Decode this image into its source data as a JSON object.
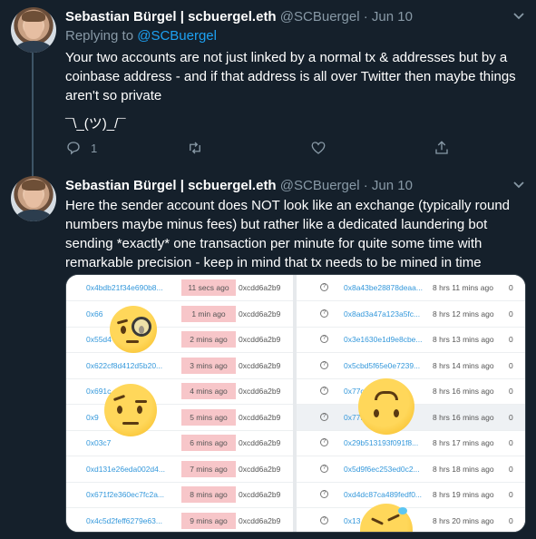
{
  "tweets": [
    {
      "name": "Sebastian Bürgel | scbuergel.eth",
      "handle": "@SCBuergel",
      "separator": "·",
      "date": "Jun 10",
      "replying_label": "Replying to",
      "replying_handle": "@SCBuergel",
      "text": "Your two accounts are not just linked by a normal tx & addresses but by a coinbase address - and if that address is all over Twitter then maybe things aren't so private",
      "shrug": "¯\\_(ツ)_/¯",
      "actions": {
        "reply_count": "1",
        "retweet_count": "",
        "like_count": ""
      }
    },
    {
      "name": "Sebastian Bürgel | scbuergel.eth",
      "handle": "@SCBuergel",
      "separator": "·",
      "date": "Jun 10",
      "text": "Here the sender account does NOT look like an exchange (typically round numbers maybe minus fees) but rather like a dedicated laundering bot sending *exactly* one transaction per minute for quite some time with remarkable precision - keep in mind that tx needs to be mined in time"
    }
  ],
  "media": {
    "left_rows": [
      {
        "hash": "0x4bdb21f34e690b8...",
        "age": "11 secs ago",
        "to": "0xcdd6a2b9"
      },
      {
        "hash": "0x66",
        "age": "1 min ago",
        "to": "0xcdd6a2b9"
      },
      {
        "hash": "0x55d4",
        "age": "2 mins ago",
        "to": "0xcdd6a2b9"
      },
      {
        "hash": "0x622cf8d412d5b20...",
        "age": "3 mins ago",
        "to": "0xcdd6a2b9"
      },
      {
        "hash": "0x691c",
        "age": "4 mins ago",
        "to": "0xcdd6a2b9"
      },
      {
        "hash": "0x9",
        "age": "5 mins ago",
        "to": "0xcdd6a2b9"
      },
      {
        "hash": "0x03c7",
        "age": "6 mins ago",
        "to": "0xcdd6a2b9"
      },
      {
        "hash": "0xd131e26eda002d4...",
        "age": "7 mins ago",
        "to": "0xcdd6a2b9"
      },
      {
        "hash": "0x671f2e360ec7fc2a...",
        "age": "8 mins ago",
        "to": "0xcdd6a2b9"
      },
      {
        "hash": "0x4c5d2feff6279e63...",
        "age": "9 mins ago",
        "to": "0xcdd6a2b9"
      }
    ],
    "right_rows": [
      {
        "hash": "0x8a43be28878deaa...",
        "age": "8 hrs 11 mins ago",
        "extra": "0"
      },
      {
        "hash": "0x8ad3a47a123a5fc...",
        "age": "8 hrs 12 mins ago",
        "extra": "0"
      },
      {
        "hash": "0x3e1630e1d9e8cbe...",
        "age": "8 hrs 13 mins ago",
        "extra": "0"
      },
      {
        "hash": "0x5cbd5f65e0e7239...",
        "age": "8 hrs 14 mins ago",
        "extra": "0"
      },
      {
        "hash": "0x77c",
        "age": "8 hrs 16 mins ago",
        "extra": "0"
      },
      {
        "hash": "0x77f4",
        "age": "8 hrs 16 mins ago",
        "extra": "0"
      },
      {
        "hash": "0x29b513193f091f8...",
        "age": "8 hrs 17 mins ago",
        "extra": "0"
      },
      {
        "hash": "0x5d9f6ec253ed0c2...",
        "age": "8 hrs 18 mins ago",
        "extra": "0"
      },
      {
        "hash": "0xd4dc87ca489fedf0...",
        "age": "8 hrs 19 mins ago",
        "extra": "0"
      },
      {
        "hash": "0x13",
        "age": "8 hrs 20 mins ago",
        "extra": "0"
      }
    ],
    "icon_glyph": "?"
  },
  "icons": {
    "reply": "reply-icon",
    "retweet": "retweet-icon",
    "like": "heart-icon",
    "share": "share-icon",
    "more": "chevron-down-icon"
  },
  "colors": {
    "background": "#15202b",
    "link": "#1da1f2",
    "muted": "#8899a6",
    "highlight": "#f7c6c9"
  }
}
